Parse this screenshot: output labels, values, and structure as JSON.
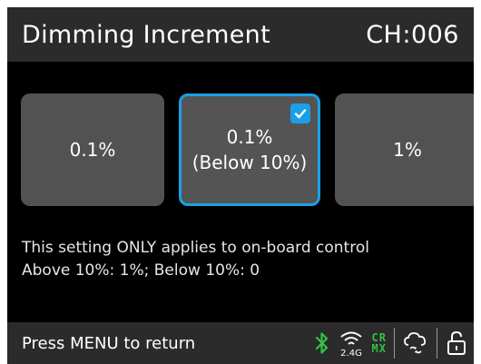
{
  "header": {
    "title": "Dimming Increment",
    "channel": "CH:006"
  },
  "options": [
    {
      "line1": "0.1%",
      "line2": "",
      "selected": false
    },
    {
      "line1": "0.1%",
      "line2": "(Below 10%)",
      "selected": true
    },
    {
      "line1": "1%",
      "line2": "",
      "selected": false
    }
  ],
  "info": {
    "line1": "This setting ONLY applies to on-board control",
    "line2": "Above 10%: 1%; Below 10%: 0"
  },
  "footer": {
    "hint": "Press MENU to return",
    "wifi_label": "2.4G",
    "crmx_top": "CR",
    "crmx_bottom": "MX"
  },
  "icons": {
    "bluetooth": "bluetooth-icon",
    "wifi": "wifi-2.4g-icon",
    "crmx": "crmx-icon",
    "cloud": "cloud-sync-icon",
    "lock": "lock-icon"
  },
  "colors": {
    "accent": "#1aa0e8",
    "bluetooth": "#33c24a",
    "crmx": "#33c24a"
  }
}
